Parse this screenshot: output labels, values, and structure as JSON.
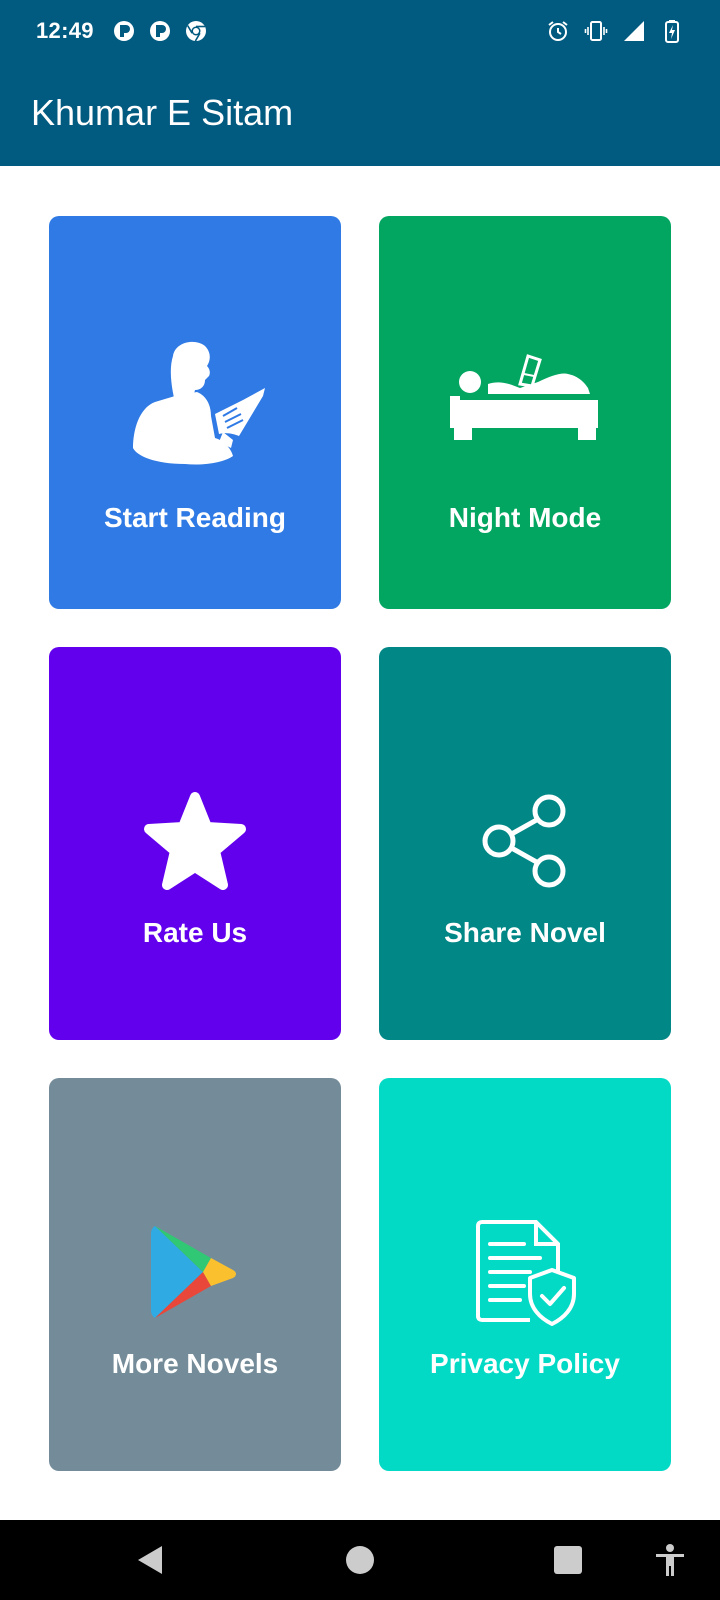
{
  "status_bar": {
    "time": "12:49",
    "left_icons": [
      "notification-app-icon",
      "notification-app-icon",
      "chrome-icon"
    ],
    "right_icons": [
      "alarm-icon",
      "vibrate-icon",
      "signal-icon",
      "battery-charging-icon"
    ]
  },
  "app_bar": {
    "title": "Khumar E Sitam"
  },
  "tiles": [
    {
      "label": "Start Reading",
      "icon": "person-reading-icon",
      "color": "#2f7ae5"
    },
    {
      "label": "Night Mode",
      "icon": "person-reading-in-bed-icon",
      "color": "#03a661"
    },
    {
      "label": "Rate Us",
      "icon": "star-icon",
      "color": "#6200ee"
    },
    {
      "label": "Share Novel",
      "icon": "share-icon",
      "color": "#018786"
    },
    {
      "label": "More Novels",
      "icon": "play-store-icon",
      "color": "#748c99"
    },
    {
      "label": "Privacy Policy",
      "icon": "privacy-document-icon",
      "color": "#03dac6"
    }
  ],
  "nav_bar": {
    "buttons": [
      "back-icon",
      "home-icon",
      "recents-icon",
      "accessibility-icon"
    ]
  },
  "colors": {
    "header": "#015a80",
    "nav": "#000000"
  }
}
